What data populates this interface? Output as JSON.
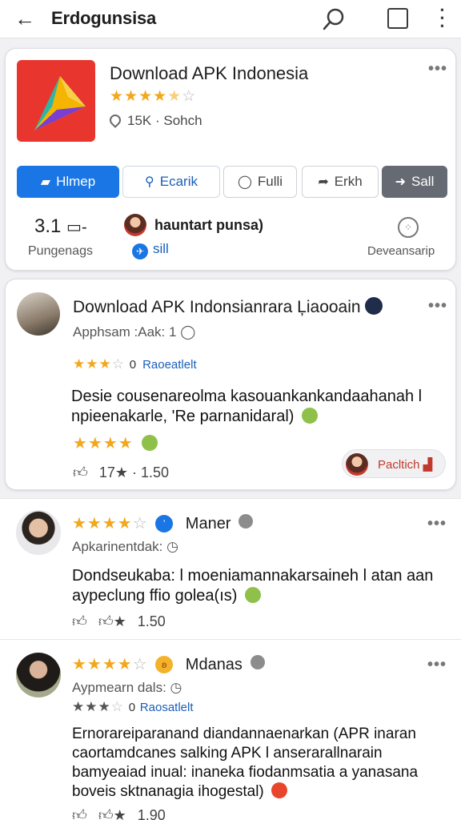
{
  "topbar": {
    "title": "Erdogunsisa",
    "icons": [
      "back-arrow-icon",
      "search-icon",
      "square-icon",
      "more-vertical-icon"
    ]
  },
  "app": {
    "name": "Download APK Indonesia",
    "rating_stars": 4.5,
    "meta": "15K · Sohch",
    "more": "•••",
    "buttons": [
      {
        "label": "Hlmep",
        "icon": "folder-icon"
      },
      {
        "label": "Ecarik",
        "icon": "search-icon"
      },
      {
        "label": "Fulli",
        "icon": "comment-icon"
      },
      {
        "label": "Erkh",
        "icon": "share-icon"
      },
      {
        "label": "Sall",
        "icon": "forward-icon"
      }
    ],
    "stats": {
      "rating_value": "3.1",
      "rating_label": "Pungenags",
      "user_name": "hauntart punsa)",
      "user_sub": "sill",
      "dev_label": "Deveansarip"
    }
  },
  "featured_review": {
    "title": "Download APK Indonsianrara Ļiaooain",
    "subtitle": "Apphsam :Aak: 1",
    "stars": 3,
    "stars_tag": "Raoeatlelt",
    "rating_glyph": "0",
    "body": "Desie cousenareolma kasouankankandaahanah l npieenakarle, 'Re parnanidaral)",
    "body_stars": 4,
    "likes": "17★ · 1.50",
    "pill_label": "Pacltich",
    "more": "•••"
  },
  "reviews": [
    {
      "stars": 4,
      "name": "Maner",
      "subtitle": "Apkarinentdak:",
      "body": "Dondseukaba: l moeniamannakarsaineh l atan aan aypeclung ffio golea(ıs)",
      "foot": "1.50",
      "more": "•••"
    },
    {
      "stars": 4,
      "name": "Mdanas",
      "subtitle": "Aypmearn dals:",
      "stars2": 3,
      "stars2_tag": "Raosatlelt",
      "rating_glyph": "0",
      "body": "Ernorareiparanand diandannaenarkan (APR inaran caortamdcanes salking APK l anserarallnarain bamyeaiad inual: inaneka fiodanmsatia a yanasana boveis sktnanagia ihogestal)",
      "foot": "1.90",
      "more": "•••"
    }
  ],
  "colors": {
    "primary": "#1976e4",
    "star": "#f3a71b",
    "app_icon_bg": "#e8352d"
  }
}
